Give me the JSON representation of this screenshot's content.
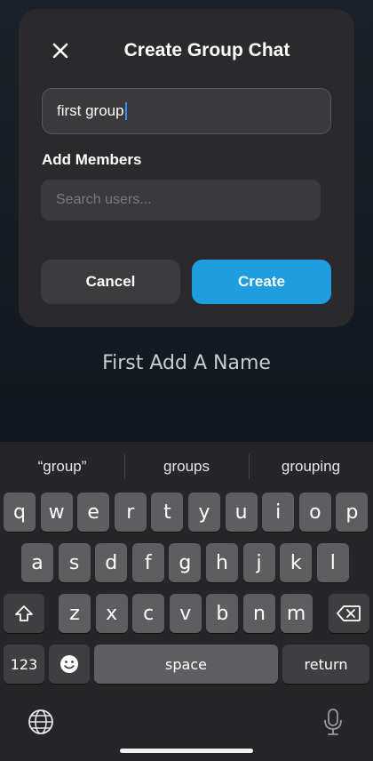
{
  "modal": {
    "title": "Create Group Chat",
    "name_value": "first group",
    "members_label": "Add Members",
    "search_placeholder": "Search users...",
    "cancel_label": "Cancel",
    "create_label": "Create",
    "create_color": "#1e9de0"
  },
  "hint_text": "First Add A Name",
  "keyboard": {
    "predictions": [
      "“group”",
      "groups",
      "grouping"
    ],
    "row1": [
      "q",
      "w",
      "e",
      "r",
      "t",
      "y",
      "u",
      "i",
      "o",
      "p"
    ],
    "row2": [
      "a",
      "s",
      "d",
      "f",
      "g",
      "h",
      "j",
      "k",
      "l"
    ],
    "row3": [
      "z",
      "x",
      "c",
      "v",
      "b",
      "n",
      "m"
    ],
    "numbers_label": "123",
    "space_label": "space",
    "return_label": "return",
    "icons": [
      "shift-icon",
      "delete-icon",
      "emoji-icon",
      "globe-icon",
      "microphone-icon"
    ]
  }
}
